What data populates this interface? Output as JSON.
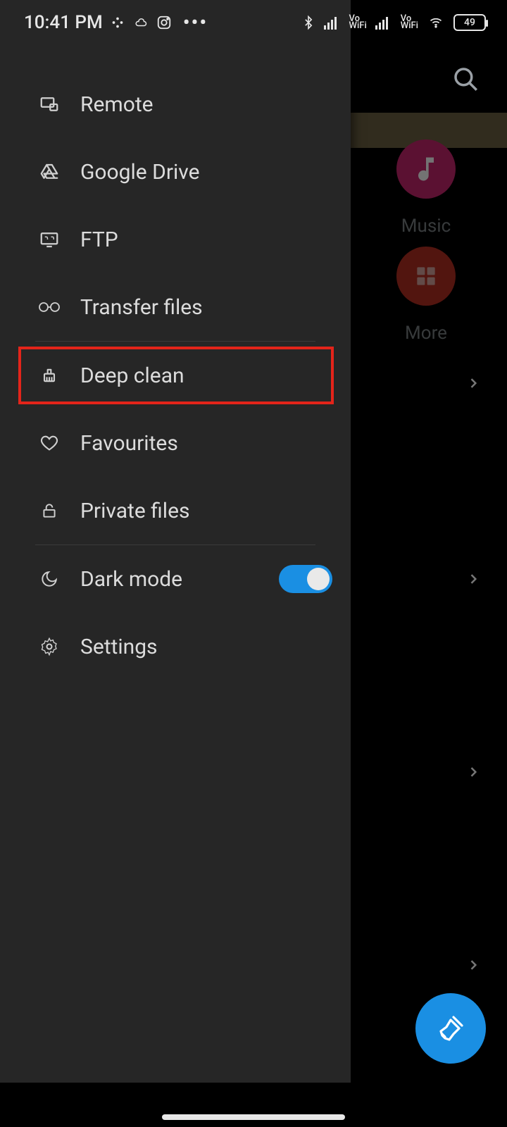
{
  "status_bar": {
    "time": "10:41 PM",
    "battery_percent": "49"
  },
  "background": {
    "tiles": {
      "music": "Music",
      "more": "More"
    }
  },
  "drawer": {
    "items": {
      "remote": "Remote",
      "google_drive": "Google Drive",
      "ftp": "FTP",
      "transfer_files": "Transfer files",
      "deep_clean": "Deep clean",
      "favourites": "Favourites",
      "private_files": "Private files",
      "dark_mode": "Dark mode",
      "settings": "Settings"
    },
    "dark_mode_on": true
  }
}
